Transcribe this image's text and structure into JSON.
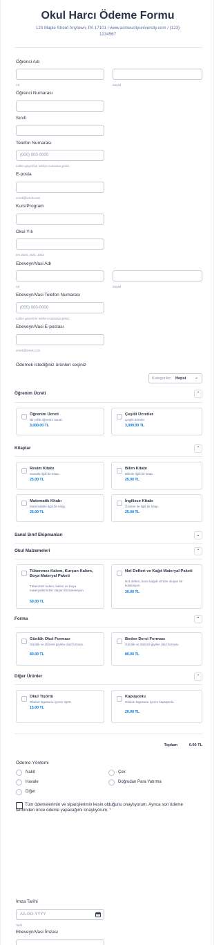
{
  "form": {
    "title": "Okul Harcı Ödeme Formu",
    "address_line1": "123 Maple Street Anytown, PA 17101 / www.acmescityuniversity.com / (123)",
    "address_line2": "1234567"
  },
  "fields": {
    "student_name_label": "Öğrenci Adı",
    "first_sub": "Ad",
    "last_sub": "Soyad",
    "student_number_label": "Öğrenci Numarası",
    "class_label": "Sınıfı",
    "phone_label": "Telefon Numarası",
    "phone_placeholder": "(000) 000-0000",
    "phone_help": "Lütfen geçerli bir telefon numarası giriniz.",
    "email_label": "E-posta",
    "email_sub": "ornek@ornek.com",
    "course_label": "Kurs/Program",
    "school_year_label": "Okul Yılı",
    "school_year_sub": "örn 2020, 2021, 2022",
    "parent_name_label": "Ebeveyn/Vasi Adı",
    "parent_first_sub": "Ad",
    "parent_last_sub": "Soyad",
    "parent_phone_label": "Ebeveyn/Vasi Telefon Numarası",
    "parent_phone_placeholder": "(000) 000-0000",
    "parent_phone_help": "Lütfen geçerli bir telefon numarası giriniz.",
    "parent_email_label": "Ebeveyn/Vasi E-postası",
    "parent_email_sub": "ornek@ornek.com"
  },
  "products": {
    "heading": "Ödemek istediğiniz ürünleri seçiniz",
    "category_label": "Kategoriler:",
    "category_value": "Hepsi",
    "sections": {
      "tuition": {
        "title": "Öğrenim Ücreti",
        "items": [
          {
            "name": "Öğrenim Ücreti",
            "desc": "Bir yıllık öğrenim ücreti.",
            "price": "3,000.00 TL"
          },
          {
            "name": "Çeşitli Ücretler",
            "desc": "Çeşitli ürünler.",
            "price": "3,000.00 TL"
          }
        ]
      },
      "books": {
        "title": "Kitaplar",
        "items": [
          {
            "name": "Resim Kitabı",
            "desc": "Sanatla ilgili bir kitap.",
            "price": "25.00 TL"
          },
          {
            "name": "Bilim Kitabı",
            "desc": "Bilimle ilgili bir kitap.",
            "price": "25.00 TL"
          },
          {
            "name": "Matematik Kitabı",
            "desc": "Matematikle ilgili bir kitap.",
            "price": "25.00 TL"
          },
          {
            "name": "İngilizce Kitabı",
            "desc": "Gramer ile ilgili bir kitap.",
            "price": "25.00 TL"
          }
        ]
      },
      "virtual": {
        "title": "Sanal Sınıf Ekipmanları"
      },
      "supplies": {
        "title": "Okul Malzemeleri",
        "items": [
          {
            "name": "Tükenmez Kalem, Kurşun Kalem, Boya Materyal Paketi",
            "desc": "Tükenmez kalem, kalem ve boya materyallerinden oluşan bir koleksiyon.",
            "price": "50.00 TL"
          },
          {
            "name": "Not Defteri ve Kağıt Materyal Paketi",
            "desc": "Not defteri, bono kağıdı vb'den oluşan bir koleksiyon.",
            "price": "30.00 TL"
          }
        ]
      },
      "uniform": {
        "title": "Forma",
        "items": [
          {
            "name": "Günlük Okul Forması",
            "desc": "Günlük ve düzenli giyilen okul forması.",
            "price": "80.00 TL"
          },
          {
            "name": "Beden Dersi Forması",
            "desc": "Günlük ve düzenli giyilen okul forması.",
            "price": "80.00 TL"
          }
        ]
      },
      "other": {
        "title": "Diğer Ürünler",
        "items": [
          {
            "name": "Okul Tişörtü",
            "desc": "Okulun logosunu içeren tişört.",
            "price": "15.00 TL"
          },
          {
            "name": "Kapüşonlu",
            "desc": "Okulun logosunu içeren kapüşonlu.",
            "price": "20.00 TL"
          }
        ]
      }
    },
    "total_label": "Toplam",
    "total_value": "0.00 TL"
  },
  "payment": {
    "label": "Ödeme Yöntemi",
    "options": [
      "Nakit",
      "Çek",
      "Havale",
      "Doğrudan Para Yatırma",
      "Diğer"
    ],
    "confirm_text": "Tüm ödemelerimin ve siparişlerimin kesin olduğunu onaylıyorum. Ayrıca son ödeme tarihinden önce ödeme yapacağımı onaylıyorum.",
    "required_mark": "*"
  },
  "signature": {
    "date_label": "İmza Tarihi",
    "date_placeholder": "AA-GG-YYYY",
    "date_sub": "Tarih",
    "signature_label": "Ebeveyn/Vasi İmzası"
  },
  "icons": {
    "chevron_up": "chevron-up-icon",
    "chevron_down": "chevron-down-icon",
    "calendar": "calendar-icon"
  },
  "colors": {
    "accent": "#0075e3",
    "text": "#2c3345",
    "muted": "#8d95ad",
    "required": "#f23a3c"
  }
}
